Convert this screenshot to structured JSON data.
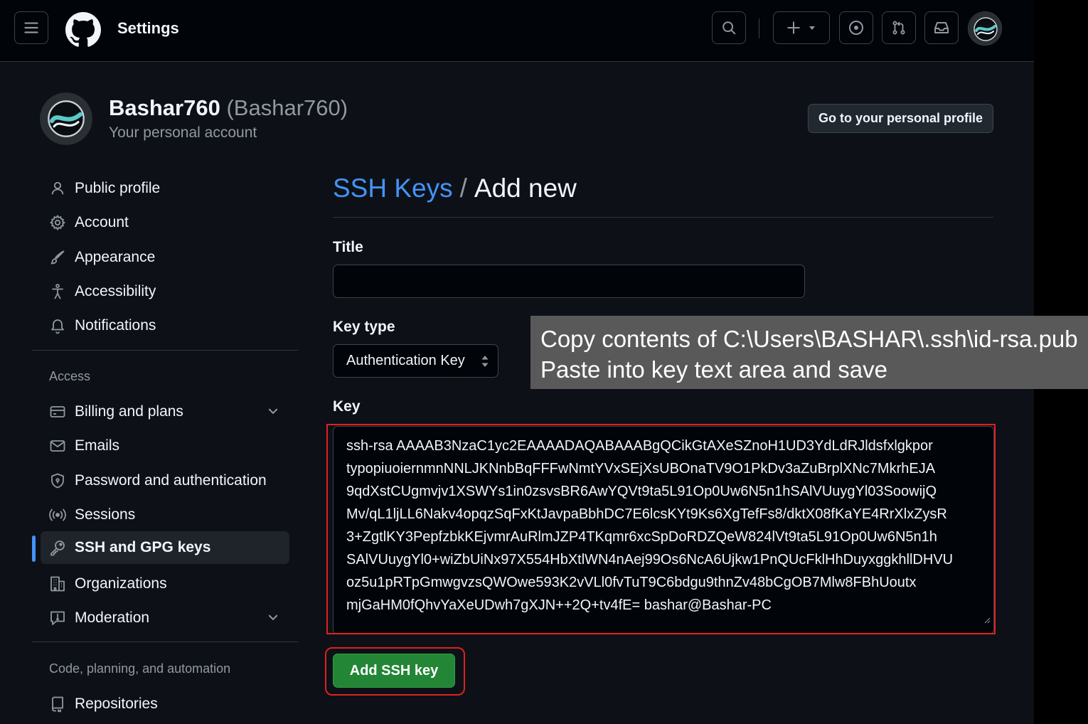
{
  "header": {
    "title": "Settings",
    "icons": [
      "menu-icon",
      "github-logo",
      "search-icon",
      "plus-icon",
      "issue-icon",
      "pull-request-icon",
      "inbox-icon",
      "avatar"
    ]
  },
  "profile": {
    "name": "Bashar760",
    "login": "(Bashar760)",
    "subtitle": "Your personal account",
    "profile_button": "Go to your personal profile"
  },
  "sidebar": {
    "items": [
      {
        "label": "Public profile",
        "icon": "person-icon"
      },
      {
        "label": "Account",
        "icon": "gear-icon"
      },
      {
        "label": "Appearance",
        "icon": "paintbrush-icon"
      },
      {
        "label": "Accessibility",
        "icon": "accessibility-icon"
      },
      {
        "label": "Notifications",
        "icon": "bell-icon"
      }
    ],
    "access_heading": "Access",
    "access_items": [
      {
        "label": "Billing and plans",
        "icon": "credit-card-icon"
      },
      {
        "label": "Emails",
        "icon": "mail-icon"
      },
      {
        "label": "Password and authentication",
        "icon": "shield-icon"
      },
      {
        "label": "Sessions",
        "icon": "broadcast-icon"
      },
      {
        "label": "SSH and GPG keys",
        "icon": "key-icon",
        "active": true
      },
      {
        "label": "Organizations",
        "icon": "organization-icon"
      },
      {
        "label": "Moderation",
        "icon": "report-icon"
      }
    ],
    "code_heading": "Code, planning, and automation",
    "code_items": [
      {
        "label": "Repositories",
        "icon": "repo-icon"
      }
    ]
  },
  "main": {
    "breadcrumb": "SSH Keys",
    "separator": "/",
    "title": "Add new",
    "title_label": "Title",
    "title_value": "",
    "key_type_label": "Key type",
    "key_type_value": "Authentication Key",
    "key_label": "Key",
    "key_lines": [
      "ssh-rsa AAAAB3NzaC1yc2EAAAADAQABAAABgQCikGtAXeSZnoH1UD3YdLdRJldsfxlgkpor",
      "typopiuoiernmnNNLJKNnbBqFFFwNmtYVxSEjXsUBOnaTV9O1PkDv3aZuBrplXNc7MkrhEJA",
      "9qdXstCUgmvjv1XSWYs1in0zsvsBR6AwYQVt9ta5L91Op0Uw6N5n1hSAlVUuygYl03SoowijQ",
      "Mv/qL1ljLL6Nakv4opqzSqFxKtJavpaBbhDC7E6lcsKYt9Ks6XgTefFs8/dktX08fKaYE4RrXlxZysR",
      "3+ZgtlKY3PepfzbkKEjvmrAuRlmJZP4TKqmr6xcSpDoRDZQeW824lVt9ta5L91Op0Uw6N5n1h",
      "SAlVUuygYl0+wiZbUiNx97X554HbXtlWN4nAej99Os6NcA6Ujkw1PnQUcFklHhDuyxggkhllDHVU",
      "oz5u1pRTpGmwgvzsQWOwe593K2vVLl0fvTuT9C6bdgu9thnZv48bCgOB7Mlw8FBhUoutx",
      "mjGaHM0fQhvYaXeUDwh7gXJN++2Q+tv4fE= bashar@Bashar-PC"
    ],
    "submit_label": "Add SSH key"
  },
  "annotation": {
    "line1": "Copy contents of C:\\Users\\BASHAR\\.ssh\\id-rsa.pub",
    "line2": "Paste into key text area and save",
    "highlight_color": "#e02020",
    "background_color": "#595959"
  },
  "colors": {
    "accent": "#4493f8",
    "primary_button": "#238636",
    "background": "#0d1117"
  }
}
